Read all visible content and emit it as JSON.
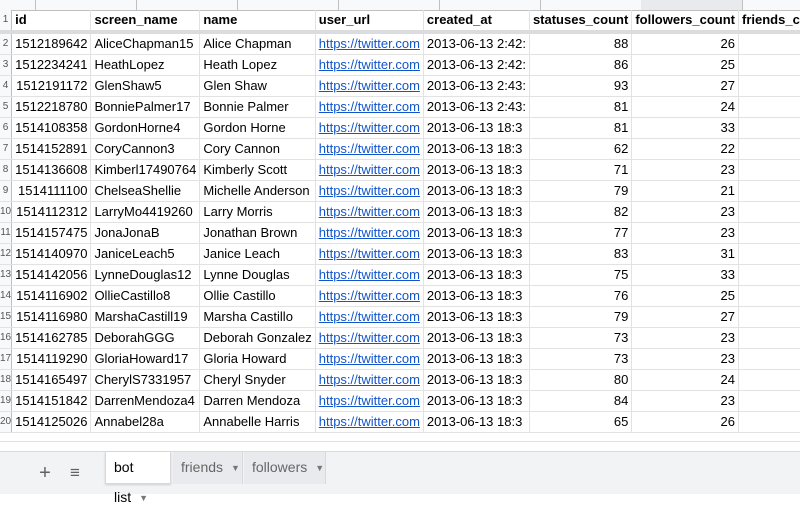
{
  "spreadsheet": {
    "columns": [
      "id",
      "screen_name",
      "name",
      "user_url",
      "created_at",
      "statuses_count",
      "followers_count",
      "friends_c"
    ],
    "rows": [
      {
        "n": "2",
        "id": "1512189642",
        "screen_name": "AliceChapman15",
        "name": "Alice Chapman",
        "user_url": "https://twitter.com",
        "created_at": "2013-06-13 2:42:",
        "statuses_count": "88",
        "followers_count": "26"
      },
      {
        "n": "3",
        "id": "1512234241",
        "screen_name": "HeathLopez",
        "name": "Heath Lopez",
        "user_url": "https://twitter.com",
        "created_at": "2013-06-13 2:42:",
        "statuses_count": "86",
        "followers_count": "25"
      },
      {
        "n": "4",
        "id": "1512191172",
        "screen_name": "GlenShaw5",
        "name": "Glen Shaw",
        "user_url": "https://twitter.com",
        "created_at": "2013-06-13 2:43:",
        "statuses_count": "93",
        "followers_count": "27"
      },
      {
        "n": "5",
        "id": "1512218780",
        "screen_name": "BonniePalmer17",
        "name": "Bonnie Palmer",
        "user_url": "https://twitter.com",
        "created_at": "2013-06-13 2:43:",
        "statuses_count": "81",
        "followers_count": "24"
      },
      {
        "n": "6",
        "id": "1514108358",
        "screen_name": "GordonHorne4",
        "name": "Gordon Horne",
        "user_url": "https://twitter.com",
        "created_at": "2013-06-13 18:3",
        "statuses_count": "81",
        "followers_count": "33"
      },
      {
        "n": "7",
        "id": "1514152891",
        "screen_name": "CoryCannon3",
        "name": "Cory Cannon",
        "user_url": "https://twitter.com",
        "created_at": "2013-06-13 18:3",
        "statuses_count": "62",
        "followers_count": "22"
      },
      {
        "n": "8",
        "id": "1514136608",
        "screen_name": "Kimberl17490764",
        "name": "Kimberly Scott",
        "user_url": "https://twitter.com",
        "created_at": "2013-06-13 18:3",
        "statuses_count": "71",
        "followers_count": "23"
      },
      {
        "n": "9",
        "id": "1514111100",
        "screen_name": "ChelseaShellie",
        "name": "Michelle Anderson",
        "user_url": "https://twitter.com",
        "created_at": "2013-06-13 18:3",
        "statuses_count": "79",
        "followers_count": "21"
      },
      {
        "n": "10",
        "id": "1514112312",
        "screen_name": "LarryMo4419260",
        "name": "Larry Morris",
        "user_url": "https://twitter.com",
        "created_at": "2013-06-13 18:3",
        "statuses_count": "82",
        "followers_count": "23"
      },
      {
        "n": "11",
        "id": "1514157475",
        "screen_name": "JonaJonaB",
        "name": "Jonathan Brown",
        "user_url": "https://twitter.com",
        "created_at": "2013-06-13 18:3",
        "statuses_count": "77",
        "followers_count": "23"
      },
      {
        "n": "12",
        "id": "1514140970",
        "screen_name": "JaniceLeach5",
        "name": "Janice Leach",
        "user_url": "https://twitter.com",
        "created_at": "2013-06-13 18:3",
        "statuses_count": "83",
        "followers_count": "31"
      },
      {
        "n": "13",
        "id": "1514142056",
        "screen_name": "LynneDouglas12",
        "name": "Lynne Douglas",
        "user_url": "https://twitter.com",
        "created_at": "2013-06-13 18:3",
        "statuses_count": "75",
        "followers_count": "33"
      },
      {
        "n": "14",
        "id": "1514116902",
        "screen_name": "OllieCastillo8",
        "name": "Ollie Castillo",
        "user_url": "https://twitter.com",
        "created_at": "2013-06-13 18:3",
        "statuses_count": "76",
        "followers_count": "25"
      },
      {
        "n": "15",
        "id": "1514116980",
        "screen_name": "MarshaCastill19",
        "name": "Marsha Castillo",
        "user_url": "https://twitter.com",
        "created_at": "2013-06-13 18:3",
        "statuses_count": "79",
        "followers_count": "27"
      },
      {
        "n": "16",
        "id": "1514162785",
        "screen_name": "DeborahGGG",
        "name": "Deborah Gonzalez",
        "user_url": "https://twitter.com",
        "created_at": "2013-06-13 18:3",
        "statuses_count": "73",
        "followers_count": "23"
      },
      {
        "n": "17",
        "id": "1514119290",
        "screen_name": "GloriaHoward17",
        "name": "Gloria Howard",
        "user_url": "https://twitter.com",
        "created_at": "2013-06-13 18:3",
        "statuses_count": "73",
        "followers_count": "23"
      },
      {
        "n": "18",
        "id": "1514165497",
        "screen_name": "CherylS7331957",
        "name": "Cheryl Snyder",
        "user_url": "https://twitter.com",
        "created_at": "2013-06-13 18:3",
        "statuses_count": "80",
        "followers_count": "24"
      },
      {
        "n": "19",
        "id": "1514151842",
        "screen_name": "DarrenMendoza4",
        "name": "Darren Mendoza",
        "user_url": "https://twitter.com",
        "created_at": "2013-06-13 18:3",
        "statuses_count": "84",
        "followers_count": "23"
      },
      {
        "n": "20",
        "id": "1514125026",
        "screen_name": "Annabel28a",
        "name": "Annabelle Harris",
        "user_url": "https://twitter.com",
        "created_at": "2013-06-13 18:3",
        "statuses_count": "65",
        "followers_count": "26"
      }
    ]
  },
  "tabbar": {
    "add_icon": "plus-icon",
    "list_icon": "menu-lines-icon",
    "tabs": [
      {
        "label": "bot list",
        "active": true
      },
      {
        "label": "friends",
        "active": false
      },
      {
        "label": "followers",
        "active": false
      }
    ]
  },
  "colors": {
    "link": "#1155cc",
    "header_bg": "#f8f9fa",
    "tabbar_bg": "#f1f3f4"
  }
}
